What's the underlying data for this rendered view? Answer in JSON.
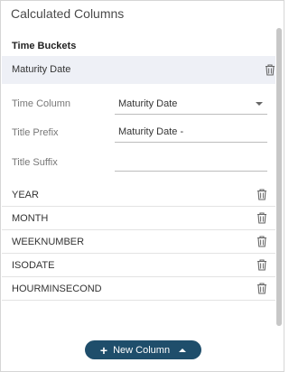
{
  "panel": {
    "title": "Calculated Columns"
  },
  "section": {
    "title": "Time Buckets"
  },
  "selected_item": {
    "label": "Maturity Date"
  },
  "fields": {
    "time_column": {
      "label": "Time Column",
      "value": "Maturity Date"
    },
    "title_prefix": {
      "label": "Title Prefix",
      "value": "Maturity Date -"
    },
    "title_suffix": {
      "label": "Title Suffix",
      "value": ""
    }
  },
  "buckets": [
    {
      "label": "YEAR"
    },
    {
      "label": "MONTH"
    },
    {
      "label": "WEEKNUMBER"
    },
    {
      "label": "ISODATE"
    },
    {
      "label": "HOURMINSECOND"
    }
  ],
  "footer": {
    "new_column_label": "New Column"
  },
  "colors": {
    "button_bg": "#1f4e6b",
    "selected_row_bg": "#eef0f6"
  },
  "icons": {
    "delete": "trash-icon",
    "add": "plus-icon",
    "expand": "caret-up-icon",
    "dropdown": "chevron-down-icon"
  }
}
